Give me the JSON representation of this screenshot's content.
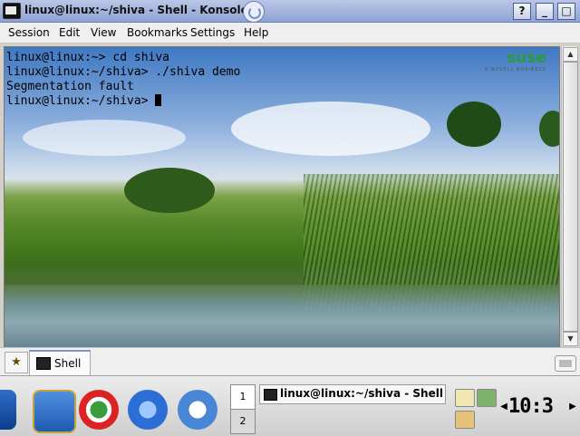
{
  "window": {
    "title": "linux@linux:~/shiva - Shell - Konsole",
    "buttons": {
      "help": "?",
      "minimize": "_",
      "maximize": "□",
      "close": "×"
    }
  },
  "menubar": {
    "items": [
      "Session",
      "Edit",
      "View",
      "Bookmarks",
      "Settings",
      "Help"
    ]
  },
  "terminal": {
    "lines": [
      "linux@linux:~> cd shiva",
      "linux@linux:~/shiva> ./shiva demo",
      "Segmentation fault",
      "linux@linux:~/shiva> "
    ],
    "background_logo": {
      "word": "suse",
      "tagline": "A NOVELL BUSINESS"
    }
  },
  "scrollbar": {
    "up": "▲",
    "down": "▼"
  },
  "tabbar": {
    "tabs": [
      {
        "label": "Shell",
        "active": true
      }
    ]
  },
  "taskbar": {
    "launchers": [
      "kde-menu-icon",
      "home-folder-icon",
      "yast-lifesaver-icon",
      "konqueror-browser-icon",
      "kontact-mail-icon"
    ],
    "pager": {
      "desktops": [
        "1",
        "2"
      ],
      "active": "1"
    },
    "tasks": [
      {
        "label": "linux@linux:~/shiva - Shell - K",
        "active": true
      }
    ],
    "clock": "10:3",
    "arrows": {
      "left": "◀",
      "right": "▶"
    }
  },
  "colors": {
    "titlebar": "#8ea2d3",
    "menubar": "#efefef",
    "terminal_text": "#000000",
    "suse_green": "#2c9a3c"
  }
}
